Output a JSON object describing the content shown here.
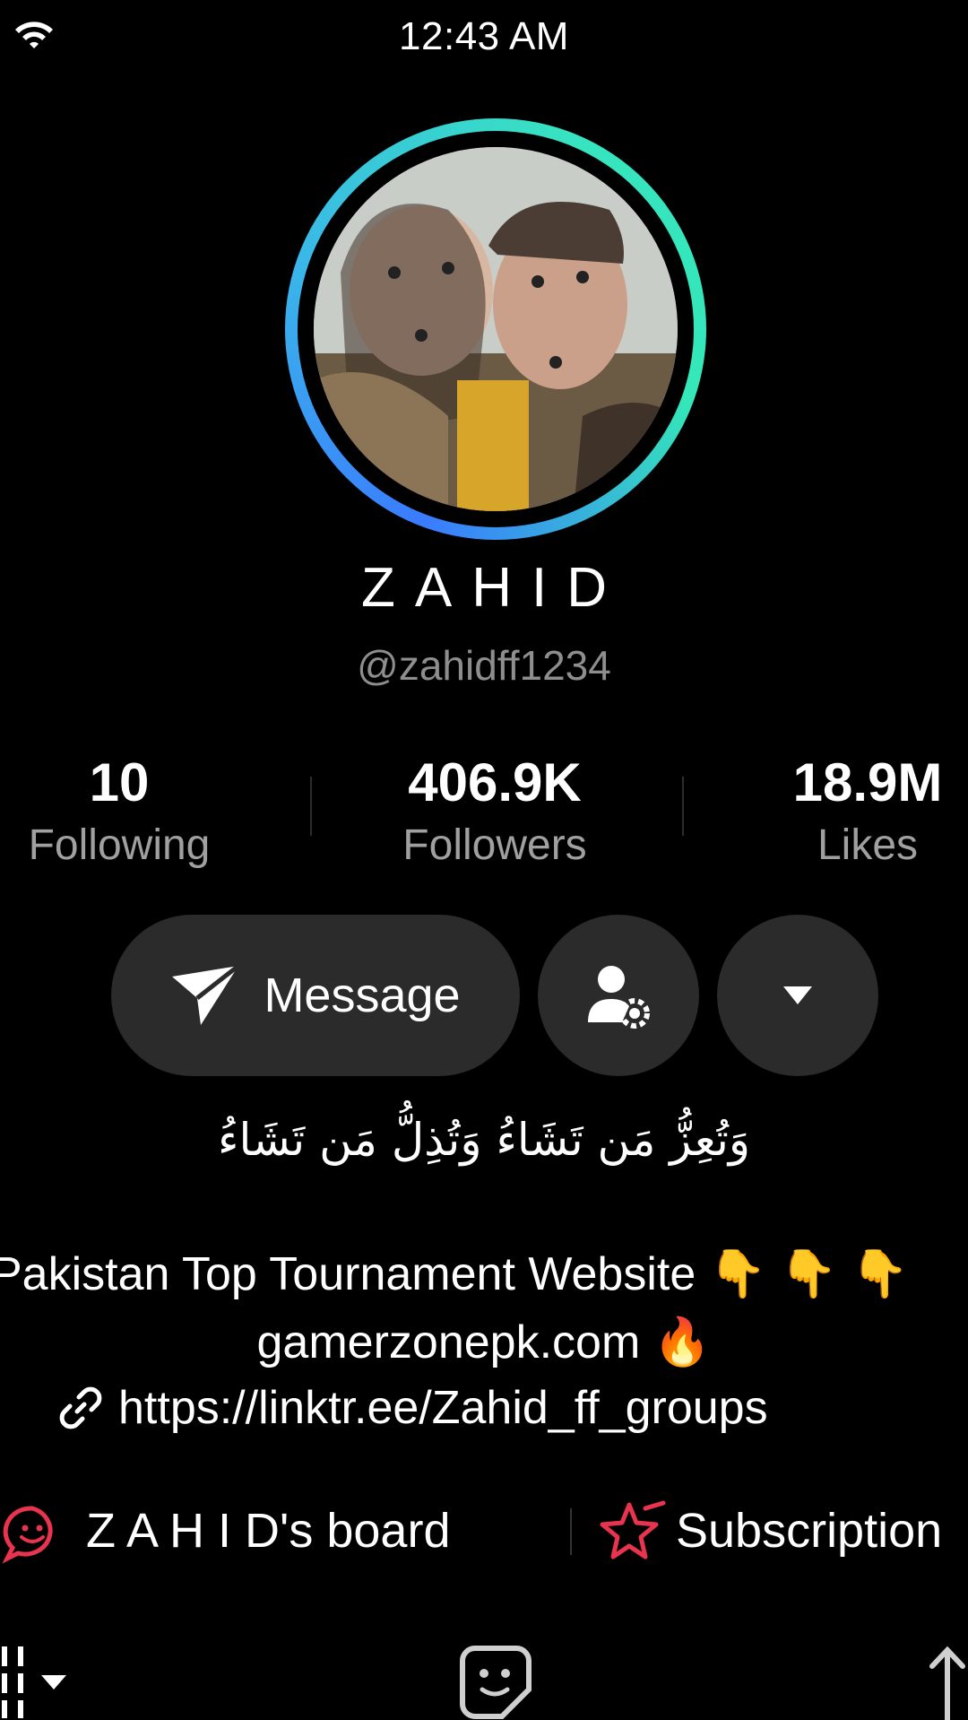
{
  "status_bar": {
    "time": "12:43 AM"
  },
  "profile": {
    "display_name": "ZAHID",
    "username": "@zahidff1234"
  },
  "stats": {
    "following": {
      "value": "10",
      "label": "Following"
    },
    "followers": {
      "value": "406.9K",
      "label": "Followers"
    },
    "likes": {
      "value": "18.9M",
      "label": "Likes"
    }
  },
  "actions": {
    "message_label": "Message"
  },
  "bio": {
    "arabic": "وَتُعِزُّ مَن تَشَاءُ وَتُذِلُّ مَن تَشَاءُ",
    "line1": "Pakistan Top Tournament Website 👇 👇 👇",
    "line2": "gamerzonepk.com 🔥",
    "link": "https://linktr.ee/Zahid_ff_groups"
  },
  "shortcuts": {
    "board": "Z A H I D's board",
    "subscription": "Subscription"
  },
  "colors": {
    "background": "#000000",
    "ring_start": "#3a7bff",
    "ring_end": "#37e3c0",
    "board_icon": "#e8344e",
    "button_bg": "#2b2b2b"
  }
}
